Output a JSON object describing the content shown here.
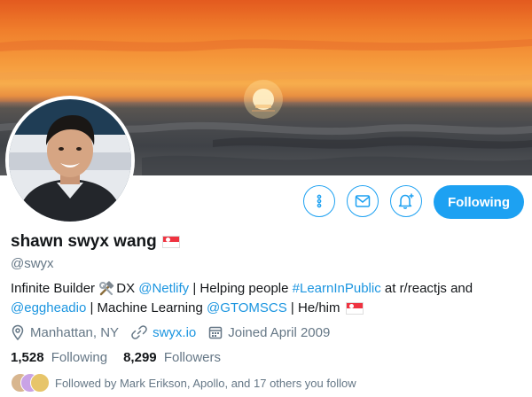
{
  "profile": {
    "name": "shawn swyx wang",
    "handle": "@swyx",
    "bio_line1": {
      "t1": "Infinite Builder ",
      "t2": "DX ",
      "netlify": "@Netlify",
      "t3": " | Helping people ",
      "learn": "#LearnInPublic",
      "t4": " at r/reactjs and"
    },
    "bio_line2": {
      "egghead": "@eggheadio",
      "t5": " | Machine Learning ",
      "gtom": "@GTOMSCS",
      "t6": " | He/him"
    },
    "location": "Manhattan, NY",
    "website": "swyx.io",
    "joined": "Joined April 2009",
    "following_count": "1,528",
    "following_label": "Following",
    "followers_count": "8,299",
    "followers_label": "Followers",
    "followed_by": "Followed by Mark Erikson, Apollo, and 17 others you follow"
  },
  "actions": {
    "follow_label": "Following"
  },
  "icons": {
    "more": "more-vertical-icon",
    "mail": "envelope-icon",
    "notify": "bell-plus-icon",
    "location": "map-pin-icon",
    "link": "link-icon",
    "calendar": "calendar-icon",
    "tools": "hammer-wrench-icon",
    "flag": "singapore-flag-icon"
  },
  "colors": {
    "accent": "#1da1f2",
    "link": "#1b95e0",
    "muted": "#657786"
  }
}
